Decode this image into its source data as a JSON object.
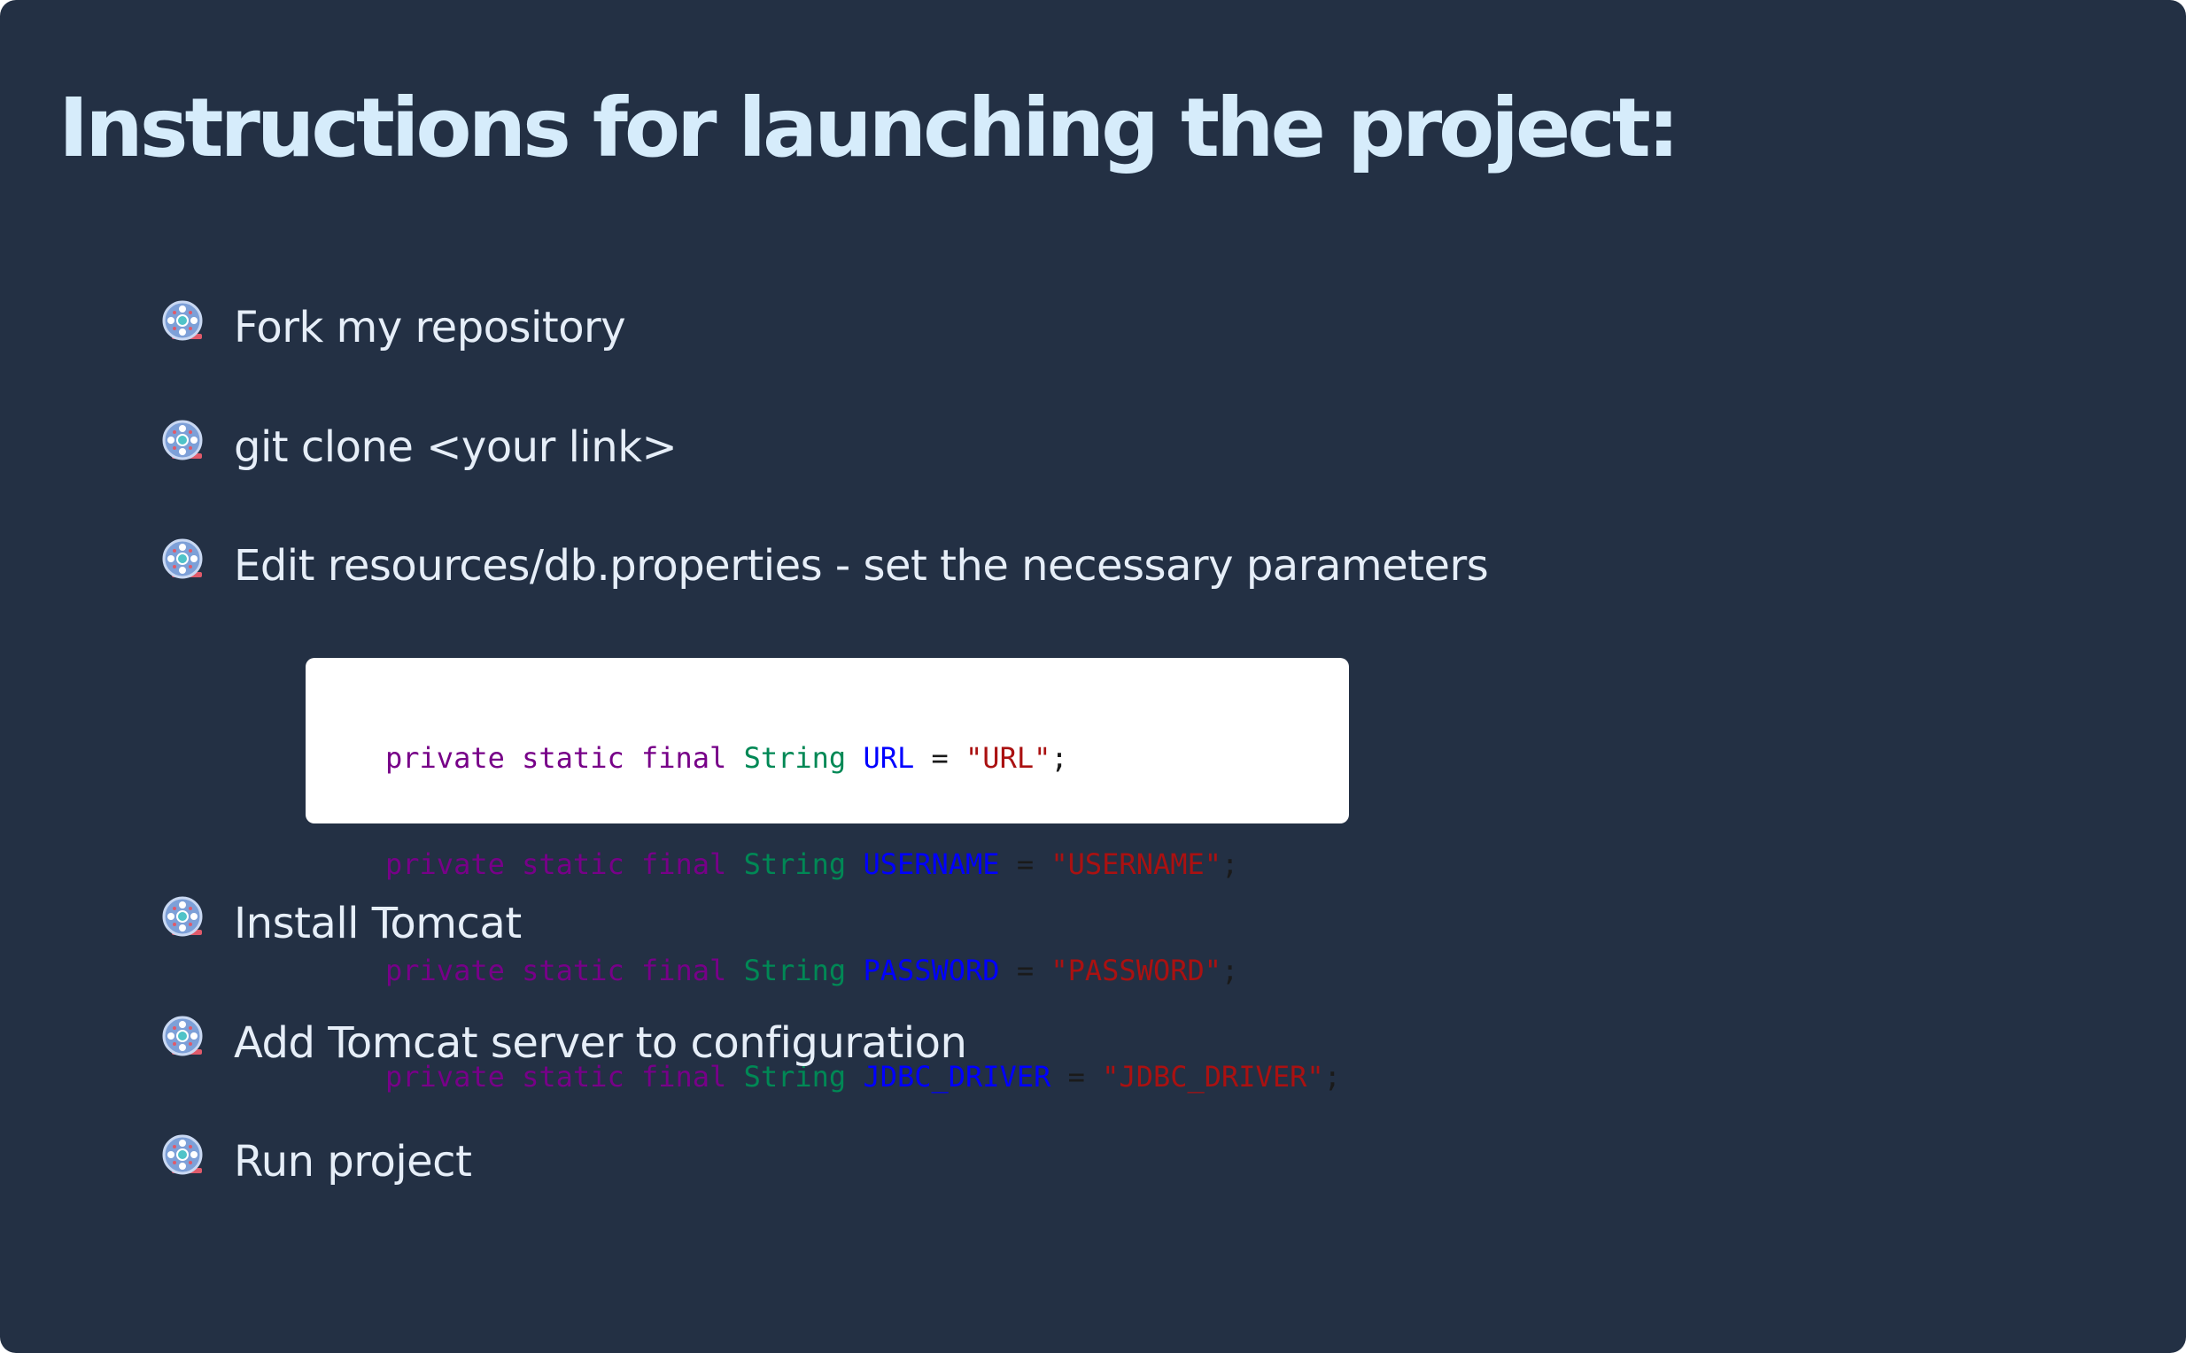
{
  "title": "Instructions for launching the project:",
  "colors": {
    "background": "#233044",
    "title": "#d6ecfb",
    "text": "#e6eef8",
    "code_bg": "#ffffff",
    "code_keyword": "#770088",
    "code_type": "#008855",
    "code_identifier": "#0000ff",
    "code_string": "#aa1111"
  },
  "bullet_icon": "film-reel-icon",
  "steps": [
    {
      "label": "Fork my repository"
    },
    {
      "label": "git clone <your link>"
    },
    {
      "label": "Edit resources/db.properties - set the necessary parameters"
    },
    {
      "label": "Install Tomcat"
    },
    {
      "label": "Add Tomcat server to configuration"
    },
    {
      "label": "Run project"
    }
  ],
  "code": {
    "lines": [
      {
        "k1": "private",
        "k2": "static",
        "k3": "final",
        "type": "String",
        "name": "URL",
        "op": "=",
        "value": "\"URL\"",
        "end": ";"
      },
      {
        "k1": "private",
        "k2": "static",
        "k3": "final",
        "type": "String",
        "name": "USERNAME",
        "op": "=",
        "value": "\"USERNAME\"",
        "end": ";"
      },
      {
        "k1": "private",
        "k2": "static",
        "k3": "final",
        "type": "String",
        "name": "PASSWORD",
        "op": "=",
        "value": "\"PASSWORD\"",
        "end": ";"
      },
      {
        "k1": "private",
        "k2": "static",
        "k3": "final",
        "type": "String",
        "name": "JDBC_DRIVER",
        "op": "=",
        "value": "\"JDBC_DRIVER\"",
        "end": ";"
      }
    ]
  }
}
